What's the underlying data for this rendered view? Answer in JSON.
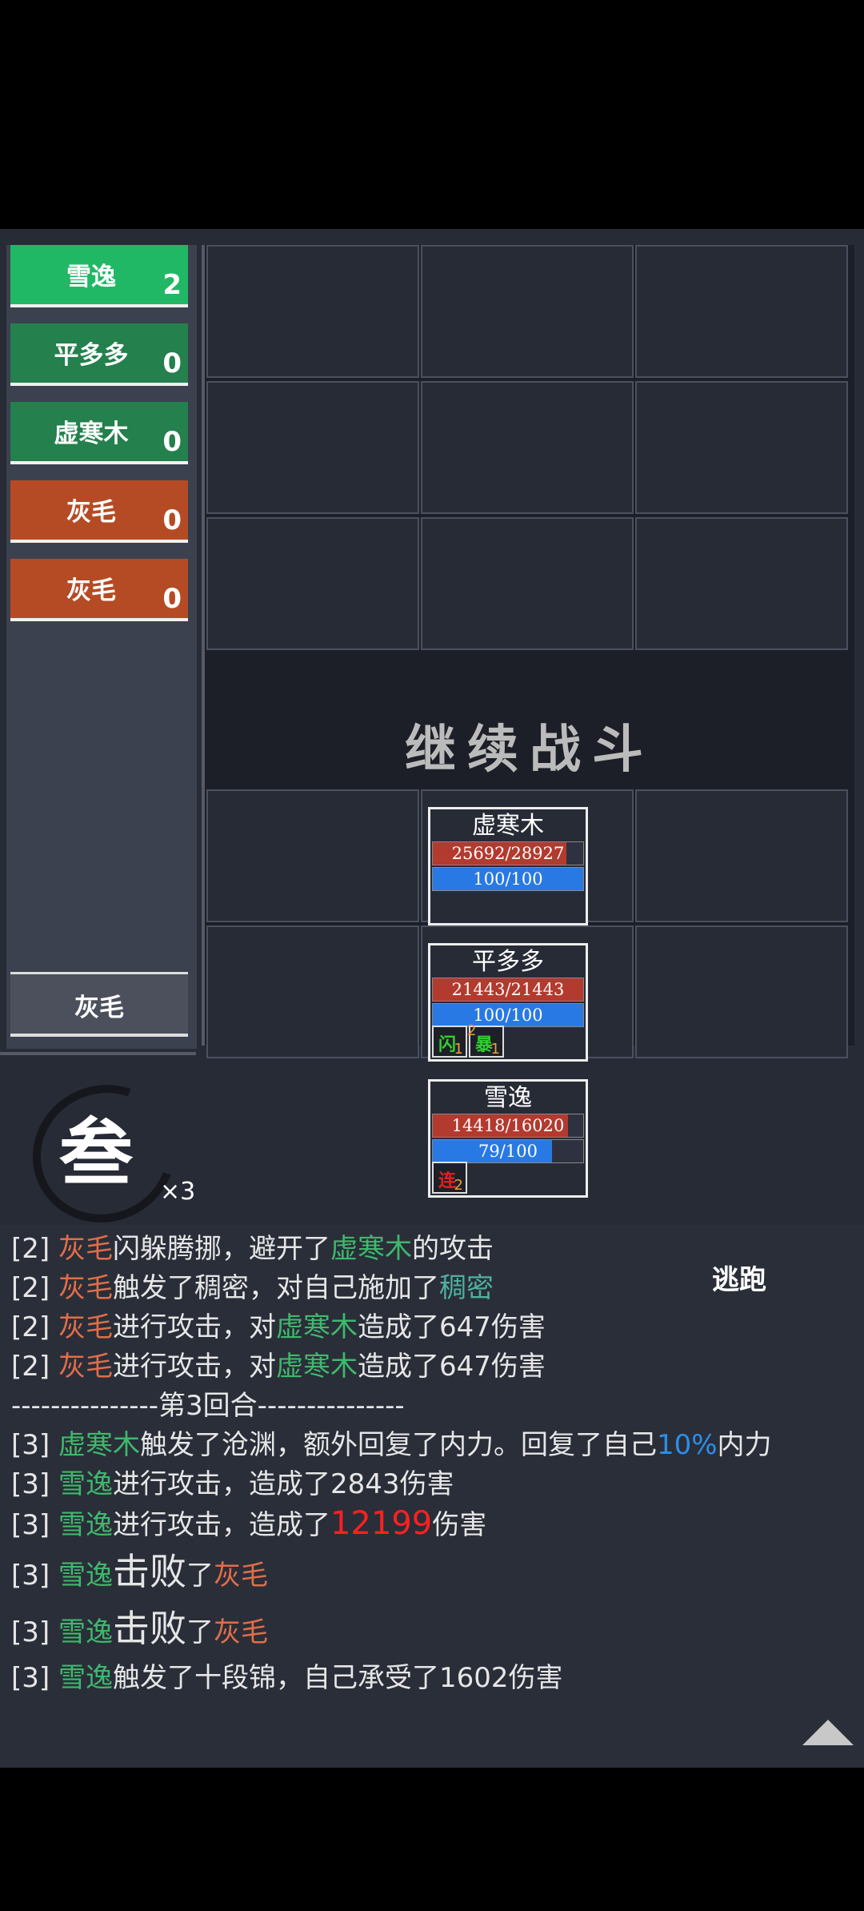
{
  "turn_order": [
    {
      "name": "雪逸",
      "count": "2",
      "color": "green-bright"
    },
    {
      "name": "平多多",
      "count": "0",
      "color": "green"
    },
    {
      "name": "虚寒木",
      "count": "0",
      "color": "green"
    },
    {
      "name": "灰毛",
      "count": "0",
      "color": "orange"
    },
    {
      "name": "灰毛",
      "count": "0",
      "color": "orange"
    }
  ],
  "current_actor": "灰毛",
  "round": {
    "char": "叁",
    "multiplier": "×3"
  },
  "continue_label": "继续战斗",
  "flee_label": "逃跑",
  "units": [
    {
      "name": "虚寒木",
      "hp_text": "25692/28927",
      "hp_frac": 0.888,
      "mp_text": "100/100",
      "mp_frac": 1.0
    },
    {
      "name": "平多多",
      "hp_text": "21443/21443",
      "hp_frac": 1.0,
      "mp_text": "100/100",
      "mp_frac": 1.0,
      "buffs": [
        {
          "glyph": "闪",
          "count": "1"
        },
        {
          "glyph": "暴",
          "count": "1",
          "top": "2"
        }
      ]
    },
    {
      "name": "雪逸",
      "hp_text": "14418/16020",
      "hp_frac": 0.9,
      "mp_text": "79/100",
      "mp_frac": 0.79,
      "buffs": [
        {
          "glyph": "连",
          "count": "2"
        }
      ]
    }
  ],
  "log": [
    {
      "p": "[2] ",
      "a": "灰毛",
      "t1": "闪躲腾挪，避开了",
      "b": "虚寒木",
      "t2": "的攻击"
    },
    {
      "p": "[2] ",
      "a": "灰毛",
      "t1": "触发了稠密，对自己施加了",
      "b": "稠密",
      "t2": ""
    },
    {
      "p": "[2] ",
      "a": "灰毛",
      "t1": "进行攻击，对",
      "b": "虚寒木",
      "t2": "造成了647伤害"
    },
    {
      "p": "[2] ",
      "a": "灰毛",
      "t1": "进行攻击，对",
      "b": "虚寒木",
      "t2": "造成了647伤害"
    },
    {
      "sep": "---------------第3回合---------------"
    },
    {
      "p": "[3] ",
      "a": "虚寒木",
      "t1": "触发了沧渊，额外回复了内力。回复了自己",
      "b": "10%",
      "t2": "内力"
    },
    {
      "p": "[3] ",
      "a": "雪逸",
      "t1": "进行攻击，造成了2843伤害"
    },
    {
      "p": "[3] ",
      "a": "雪逸",
      "t1": "进行攻击，造成了",
      "b": "12199",
      "t2": "伤害"
    },
    {
      "p": "[3] ",
      "a": "雪逸",
      "big": "击败",
      "t1": "了",
      "b": "灰毛"
    },
    {
      "p": "[3] ",
      "a": "雪逸",
      "big": "击败",
      "t1": "了",
      "b": "灰毛"
    },
    {
      "p": "[3] ",
      "a": "雪逸",
      "t1": "触发了十段锦，自己承受了1602伤害"
    }
  ]
}
